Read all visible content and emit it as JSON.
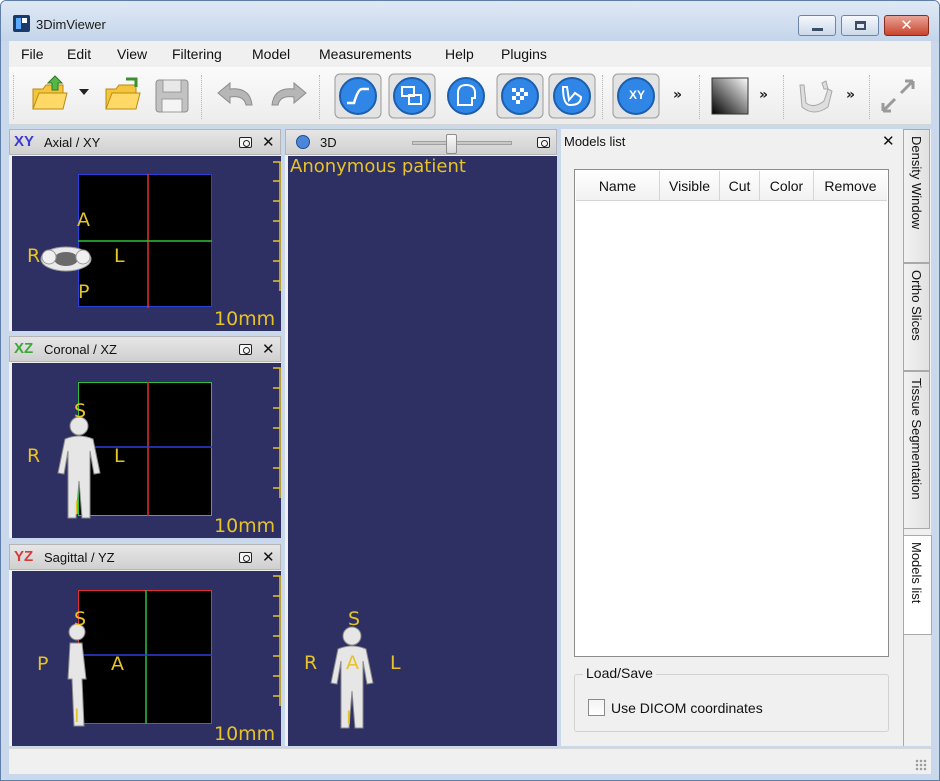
{
  "window": {
    "title": "3DimViewer"
  },
  "menu": [
    "File",
    "Edit",
    "View",
    "Filtering",
    "Model",
    "Measurements",
    "Help",
    "Plugins"
  ],
  "toolbar": {
    "overflow_label": "»",
    "xy_label": "XY"
  },
  "views": {
    "axial": {
      "code": "XY",
      "code_color": "#3b3bd4",
      "name": "Axial / XY",
      "orientation": {
        "top": "A",
        "left": "R",
        "right": "L",
        "bottom": "P"
      },
      "scale": "10mm"
    },
    "coronal": {
      "code": "XZ",
      "code_color": "#3aa83a",
      "name": "Coronal / XZ",
      "orientation": {
        "top": "S",
        "left": "R",
        "right": "L",
        "bottom": "I"
      },
      "scale": "10mm"
    },
    "sagittal": {
      "code": "YZ",
      "code_color": "#d93a3a",
      "name": "Sagittal / YZ",
      "orientation": {
        "top": "S",
        "left": "P",
        "right": "A",
        "bottom": "I"
      },
      "scale": "10mm"
    },
    "view3d": {
      "name": "3D",
      "patient": "Anonymous patient",
      "orientation": {
        "top": "S",
        "left": "R",
        "right": "L",
        "center": "A",
        "bottom": "I"
      }
    }
  },
  "models_panel": {
    "title": "Models list",
    "columns": [
      "Name",
      "Visible",
      "Cut",
      "Color",
      "Remove"
    ],
    "group_title": "Load/Save",
    "checkbox_label": "Use DICOM coordinates",
    "checkbox_checked": false
  },
  "side_tabs": [
    "Density Window",
    "Ortho Slices",
    "Tissue Segmentation",
    "Models list"
  ],
  "colors": {
    "viewport_bg": "#2e2f62",
    "orientation_text": "#e6c326",
    "red_line": "#e23030",
    "green_line": "#2fbf3a",
    "blue_line": "#2a40d8"
  }
}
